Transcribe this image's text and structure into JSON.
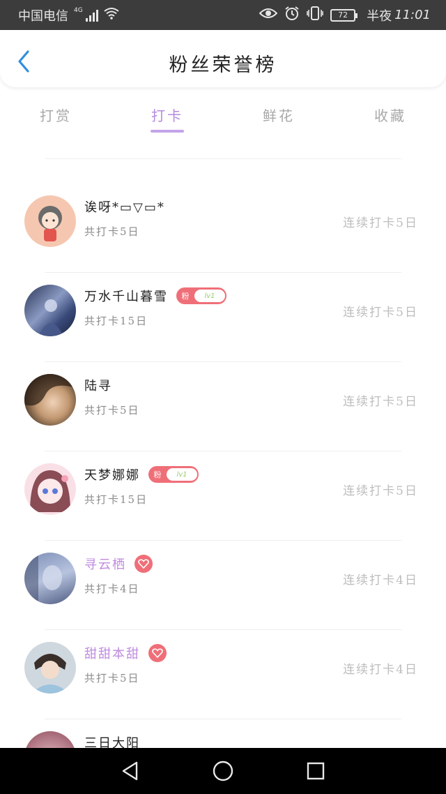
{
  "status_bar": {
    "carrier": "中国电信",
    "network": "4G",
    "battery": "72",
    "time_prefix": "半夜",
    "time": "11:01"
  },
  "header": {
    "title": "粉丝荣誉榜",
    "back_icon": "chevron-left-icon",
    "accent_color": "#2f8fe0"
  },
  "tabs": [
    {
      "label": "打赏",
      "active": false
    },
    {
      "label": "打卡",
      "active": true
    },
    {
      "label": "鲜花",
      "active": false
    },
    {
      "label": "收藏",
      "active": false
    }
  ],
  "colors": {
    "tab_active": "#b48ae0",
    "fan_badge": "#ef6f78",
    "vip_name": "#c08be0"
  },
  "fans": [
    {
      "name": "",
      "total": "",
      "streak": "",
      "badge": "none"
    },
    {
      "name": "诶呀*▭▽▭*",
      "total": "共打卡5日",
      "streak": "连续打卡5日",
      "badge": "none"
    },
    {
      "name": "万水千山暮雪",
      "total": "共打卡15日",
      "streak": "连续打卡5日",
      "badge": "fan",
      "badge_fan": "粉",
      "badge_level": "lv1"
    },
    {
      "name": "陆寻",
      "total": "共打卡5日",
      "streak": "连续打卡5日",
      "badge": "none"
    },
    {
      "name": "天梦娜娜",
      "total": "共打卡15日",
      "streak": "连续打卡5日",
      "badge": "fan",
      "badge_fan": "粉",
      "badge_level": "lv1"
    },
    {
      "name": "寻云栖",
      "total": "共打卡4日",
      "streak": "连续打卡4日",
      "badge": "heart"
    },
    {
      "name": "甜甜本甜",
      "total": "共打卡5日",
      "streak": "连续打卡4日",
      "badge": "heart"
    },
    {
      "name": "三日大阳",
      "total": "",
      "streak": "",
      "badge": "none"
    }
  ],
  "nav_bar": {
    "back": "triangle-back-icon",
    "home": "circle-home-icon",
    "recents": "square-recents-icon"
  }
}
